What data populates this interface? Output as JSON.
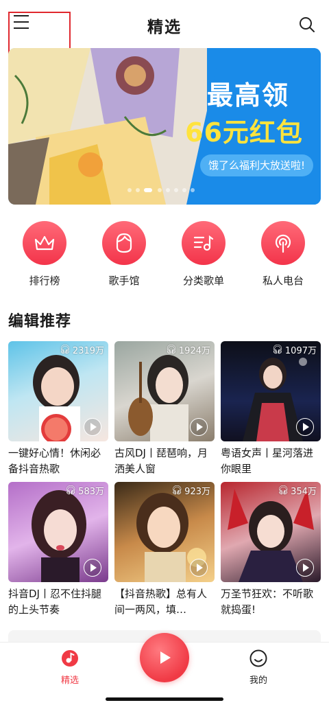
{
  "header": {
    "title": "精选"
  },
  "banner": {
    "line1": "最高领",
    "line2": "66元红包",
    "line3": "饿了么福利大放送啦!",
    "page_count": 8,
    "active_page": 2
  },
  "quick_actions": [
    {
      "label": "排行榜",
      "icon": "crown-icon"
    },
    {
      "label": "歌手馆",
      "icon": "singer-face-icon"
    },
    {
      "label": "分类歌单",
      "icon": "playlist-icon"
    },
    {
      "label": "私人电台",
      "icon": "radio-icon"
    }
  ],
  "section": {
    "title": "编辑推荐"
  },
  "playlists": [
    {
      "count": "2319万",
      "title": "一键好心情！休闲必备抖音热歌"
    },
    {
      "count": "1924万",
      "title": "古风DJ丨琵琶响，月洒美人窗"
    },
    {
      "count": "1097万",
      "title": "粤语女声丨星河落进你眼里"
    },
    {
      "count": "583万",
      "title": "抖音DJ丨忍不住抖腿的上头节奏"
    },
    {
      "count": "923万",
      "title": "【抖音热歌】总有人间一两风，填…"
    },
    {
      "count": "354万",
      "title": "万圣节狂欢：不听歌就捣蛋!"
    }
  ],
  "tabbar": {
    "left_label": "精选",
    "right_label": "我的"
  },
  "colors": {
    "accent": "#f03a45",
    "banner_blue": "#1a8be8",
    "promo_yellow": "#ffe33d"
  }
}
